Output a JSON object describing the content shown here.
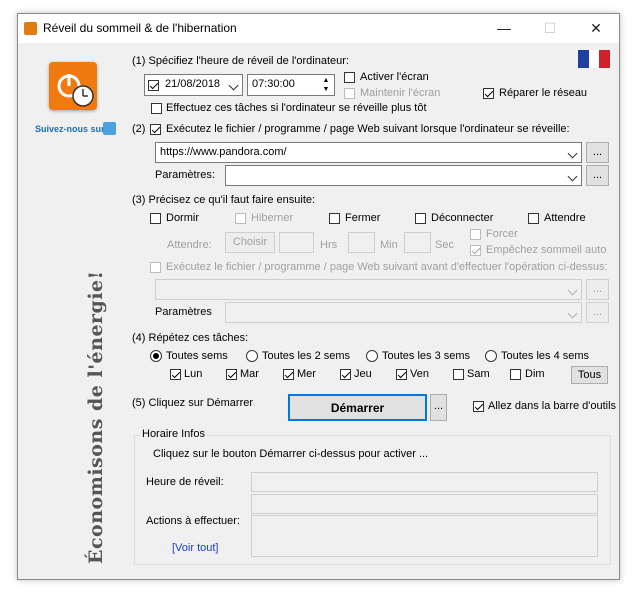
{
  "window": {
    "title": "Réveil du sommeil & de l'hibernation",
    "minimize": "—",
    "maximize": "☐",
    "close": "✕"
  },
  "sidebar": {
    "follow": "Suivez-nous sur",
    "slogan": "Économisons de l'énergie!"
  },
  "step1": {
    "label": "(1) Spécifiez l'heure de réveil de l'ordinateur:",
    "date": "21/08/2018",
    "time": "07:30:00",
    "activate_screen": "Activer l'écran",
    "keep_screen": "Maintenir l'écran",
    "repair_network": "Réparer le réseau",
    "early_wake": "Effectuez ces tâches si l'ordinateur se réveille plus tôt"
  },
  "step2": {
    "label": "Exécutez le fichier / programme / page Web suivant lorsque l'ordinateur se réveille:",
    "prefix": "(2)",
    "url": "https://www.pandora.com/",
    "params_label": "Paramètres:",
    "params_value": "",
    "browse": "..."
  },
  "step3": {
    "label": "(3) Précisez ce qu'il faut faire ensuite:",
    "sleep": "Dormir",
    "hibernate": "Hiberner",
    "close": "Fermer",
    "logoff": "Déconnecter",
    "wait": "Attendre",
    "wait_label": "Attendre:",
    "choose": "Choisir",
    "hrs": "Hrs",
    "min": "Min",
    "sec": "Sec",
    "force": "Forcer",
    "prevent_sleep": "Empêchez sommeil auto",
    "exec_before": "Exécutez le fichier / programme / page Web suivant avant d'effectuer l'opération ci-dessus:",
    "params_label": "Paramètres"
  },
  "step4": {
    "label": "(4) Répétez ces tâches:",
    "weekly": [
      "Toutes sems",
      "Toutes les 2 sems",
      "Toutes les 3 sems",
      "Toutes les 4 sems"
    ],
    "days": [
      "Lun",
      "Mar",
      "Mer",
      "Jeu",
      "Ven",
      "Sam",
      "Dim"
    ],
    "all": "Tous"
  },
  "step5": {
    "label": "(5) Cliquez sur Démarrer",
    "start": "Démarrer",
    "more": "...",
    "tray": "Allez dans la barre d'outils"
  },
  "info": {
    "title": "Horaire Infos",
    "hint": "Cliquez sur le bouton Démarrer ci-dessus pour activer ...",
    "wake_label": "Heure de réveil:",
    "actions_label": "Actions à effectuer:",
    "view_all": "[Voir tout]"
  },
  "colors": {
    "accent": "#0a3fa8",
    "link": "#1a3fc8",
    "start_border": "#0078d7"
  }
}
